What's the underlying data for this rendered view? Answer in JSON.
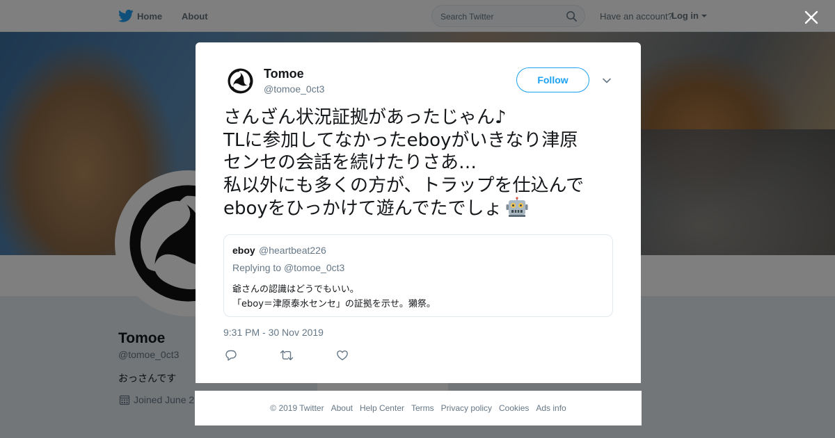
{
  "topbar": {
    "home_label": "Home",
    "about_label": "About",
    "search_placeholder": "Search Twitter",
    "have_account_text": "Have an account?",
    "login_label": "Log in"
  },
  "profile": {
    "name": "Tomoe",
    "handle": "@tomoe_0ct3",
    "bio": "おっさんです",
    "joined": "Joined June 2"
  },
  "tweet": {
    "author_name": "Tomoe",
    "author_handle": "@tomoe_0ct3",
    "follow_label": "Follow",
    "text_lines": [
      "さんざん状況証拠があったじゃん♪",
      "TLに参加してなかったeboyがいきなり津原",
      "センセの会話を続けたりさあ…",
      "私以外にも多くの方が、トラップを仕込んで",
      "eboyをひっかけて遊んでたでしょ"
    ],
    "emoji": "robot-face",
    "timestamp": "9:31 PM - 30 Nov 2019"
  },
  "quote": {
    "name": "eboy",
    "handle": "@heartbeat226",
    "replying_label": "Replying to",
    "replying_to": "@tomoe_0ct3",
    "line1": "爺さんの認識はどうでもいい。",
    "line2": "「eboy＝津原泰水センセ」の証拠を示せ。獺祭。"
  },
  "footer": {
    "copyright": "© 2019 Twitter",
    "links": [
      "About",
      "Help Center",
      "Terms",
      "Privacy policy",
      "Cookies",
      "Ads info"
    ]
  },
  "colors": {
    "twitter_blue": "#1da1f2",
    "text_primary": "#14171a",
    "text_secondary": "#657786",
    "overlay": "rgba(0,0,0,0.5)"
  },
  "icons": [
    "twitter-bird-icon",
    "search-icon",
    "caret-down-icon",
    "close-icon",
    "chevron-down-icon",
    "calendar-icon",
    "reply-icon",
    "retweet-icon",
    "like-heart-icon",
    "robot-face-emoji",
    "tomoe-avatar-icon"
  ]
}
